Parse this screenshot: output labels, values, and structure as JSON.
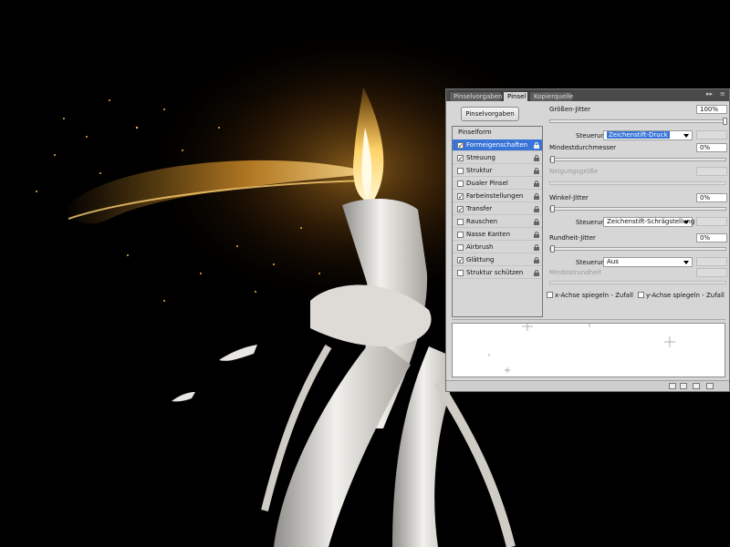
{
  "colors": {
    "panel_bg": "#d6d6d6",
    "selection": "#3874d8",
    "flame_core": "#fff6cf",
    "flame_mid": "#f2a630",
    "wax": "#e9e6e1",
    "background": "#000000"
  },
  "tabs": [
    {
      "label": "Pinselvorgaben",
      "active": false
    },
    {
      "label": "Pinsel",
      "active": true
    },
    {
      "label": "Kopierquelle",
      "active": false
    }
  ],
  "tab_controls": {
    "collapse_icon": "double-arrow-icon",
    "menu_icon": "panel-menu-icon"
  },
  "preset_button": "Pinselvorgaben",
  "list": {
    "header": "Pinselform",
    "items": [
      {
        "label": "Formeigenschaften",
        "checked": true,
        "selected": true
      },
      {
        "label": "Streuung",
        "checked": true,
        "selected": false
      },
      {
        "label": "Struktur",
        "checked": false,
        "selected": false
      },
      {
        "label": "Dualer Pinsel",
        "checked": false,
        "selected": false
      },
      {
        "label": "Farbeinstellungen",
        "checked": true,
        "selected": false
      },
      {
        "label": "Transfer",
        "checked": true,
        "selected": false
      },
      {
        "label": "Rauschen",
        "checked": false,
        "selected": false
      },
      {
        "label": "Nasse Kanten",
        "checked": false,
        "selected": false
      },
      {
        "label": "Airbrush",
        "checked": false,
        "selected": false
      },
      {
        "label": "Glättung",
        "checked": true,
        "selected": false
      },
      {
        "label": "Struktur schützen",
        "checked": false,
        "selected": false
      }
    ]
  },
  "settings": {
    "size_jitter": {
      "label": "Größen-Jitter",
      "value": "100%",
      "level": 1.0
    },
    "size_control": {
      "label": "Steuerung:",
      "value": "Zeichenstift-Druck"
    },
    "min_diameter": {
      "label": "Mindestdurchmesser",
      "value": "0%",
      "level": 0.0
    },
    "tilt_scale": {
      "label": "Neigungsgröße"
    },
    "angle_jitter": {
      "label": "Winkel-Jitter",
      "value": "0%",
      "level": 0.0
    },
    "angle_control": {
      "label": "Steuerung:",
      "value": "Zeichenstift-Schrägstellung"
    },
    "roundness_jitter": {
      "label": "Rundheit-Jitter",
      "value": "0%",
      "level": 0.0
    },
    "roundness_control": {
      "label": "Steuerung:",
      "value": "Aus"
    },
    "min_roundness": {
      "label": "Mindestrundheit"
    },
    "flip_x": {
      "label": "x-Achse spiegeln - Zufall",
      "checked": false
    },
    "flip_y": {
      "label": "y-Achse spiegeln - Zufall",
      "checked": false
    }
  }
}
